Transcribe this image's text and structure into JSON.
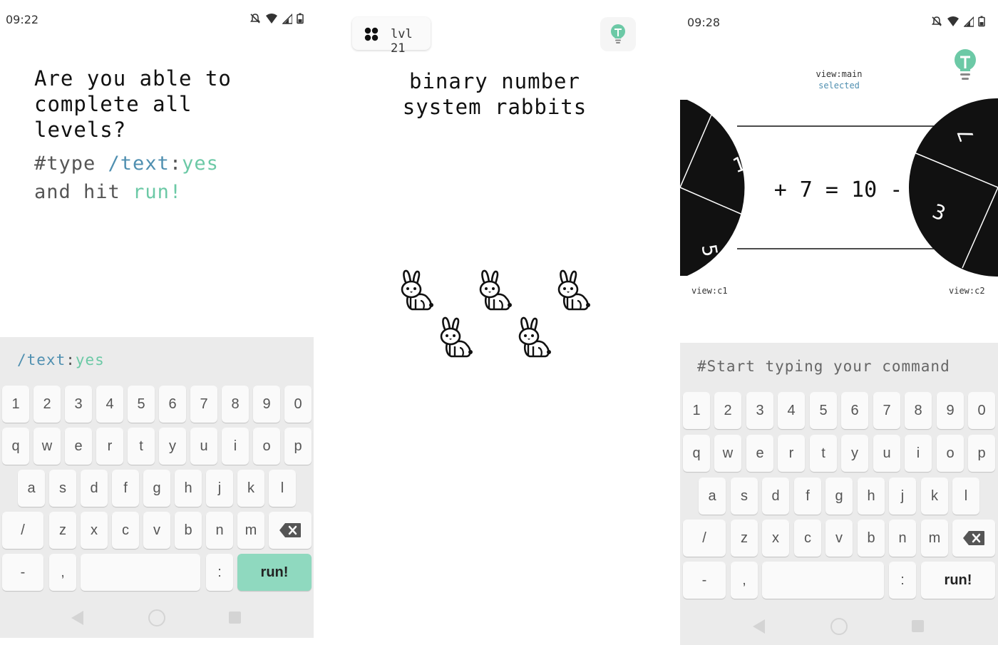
{
  "screen1": {
    "status": {
      "time": "09:22"
    },
    "intro_question": "Are you able to\ncomplete all\nlevels?",
    "instruction": {
      "hash": "#type",
      "path": "/text",
      "colon": ":",
      "value": "yes",
      "line2_prefix": "and hit",
      "run": "run!"
    },
    "command": {
      "path": "/text",
      "colon": ":",
      "value": "yes"
    },
    "keyboard": {
      "row1": [
        "1",
        "2",
        "3",
        "4",
        "5",
        "6",
        "7",
        "8",
        "9",
        "0"
      ],
      "row2": [
        "q",
        "w",
        "e",
        "r",
        "t",
        "y",
        "u",
        "i",
        "o",
        "p"
      ],
      "row3": [
        "a",
        "s",
        "d",
        "f",
        "g",
        "h",
        "j",
        "k",
        "l"
      ],
      "row4": [
        "/",
        "z",
        "x",
        "c",
        "v",
        "b",
        "n",
        "m"
      ],
      "row5": {
        "dash": "-",
        "comma": ",",
        "colon": ":",
        "run": "run!"
      }
    },
    "colors": {
      "run_key": "#8fd9bf",
      "text_blue": "#4f8fb0",
      "text_green": "#6cc9a6"
    }
  },
  "screen2": {
    "level": "lvl 21",
    "title_line1": "binary number",
    "title_line2": "system rabbits",
    "rabbit_count": 5,
    "colors": {
      "hint": "#6cc9a6"
    }
  },
  "screen3": {
    "status": {
      "time": "09:28"
    },
    "view_main": "view:main",
    "view_main_state": "selected",
    "equation": "+ 7 = 10 -",
    "wheel_left_digits": [
      "1",
      "5"
    ],
    "wheel_right_digits": [
      "7",
      "3"
    ],
    "view_c1": "view:c1",
    "view_c2": "view:c2",
    "command_placeholder": "#Start typing your command",
    "keyboard": {
      "row1": [
        "1",
        "2",
        "3",
        "4",
        "5",
        "6",
        "7",
        "8",
        "9",
        "0"
      ],
      "row2": [
        "q",
        "w",
        "e",
        "r",
        "t",
        "y",
        "u",
        "i",
        "o",
        "p"
      ],
      "row3": [
        "a",
        "s",
        "d",
        "f",
        "g",
        "h",
        "j",
        "k",
        "l"
      ],
      "row4": [
        "/",
        "z",
        "x",
        "c",
        "v",
        "b",
        "n",
        "m"
      ],
      "row5": {
        "dash": "-",
        "comma": ",",
        "colon": ":",
        "run": "run!"
      }
    }
  }
}
